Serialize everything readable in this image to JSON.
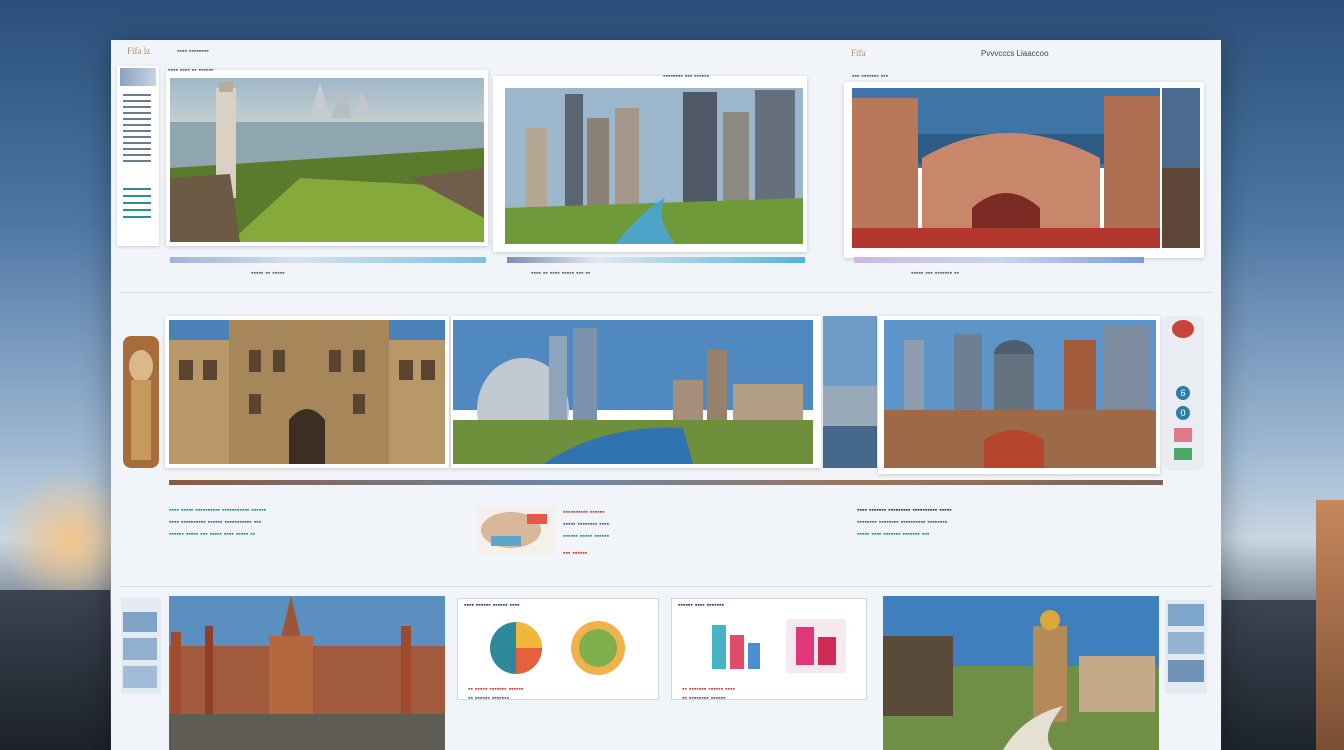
{
  "header": {
    "left_brand": "Fifa lz",
    "left_meta": "▪▪▪▪ ▪▪▪▪▪▪▪▪",
    "right_brand": "Fifa",
    "right_title": "Pvvvcccs Liaaccoo"
  },
  "card1": {
    "caption": "▪▪▪▪ ▪▪▪▪ ▪▪ ▪▪▪▪▪▪",
    "footer": "▪▪▪▪▪ ▪▪ ▪▪▪▪▪"
  },
  "card2": {
    "caption": "▪▪▪▪▪▪▪▪ ▪▪▪ ▪▪▪▪▪▪",
    "footer": "▪▪▪▪ ▪▪ ▪▪▪▪ ▪▪▪▪▪ ▪▪▪ ▪▪"
  },
  "card3": {
    "caption": "▪▪▪ ▪▪▪▪▪▪▪ ▪▪▪",
    "footer": "▪▪▪▪▪ ▪▪▪ ▪▪▪▪▪▪▪ ▪▪"
  },
  "section": {
    "text_left": [
      "▪▪▪▪ ▪▪▪▪▪ ▪▪▪▪▪▪▪▪▪▪ ▪▪▪▪▪▪▪▪▪▪▪ ▪▪▪▪▪▪",
      "▪▪▪▪ ▪▪▪▪▪▪▪▪▪▪ ▪▪▪▪▪▪ ▪▪▪▪▪▪▪▪▪▪▪ ▪▪▪",
      "▪▪▪▪▪▪ ▪▪▪▪▪ ▪▪▪ ▪▪▪▪▪ ▪▪▪▪ ▪▪▪▪▪ ▪▪"
    ],
    "text_mid": [
      "▪▪▪▪▪▪▪▪▪▪ ▪▪▪▪▪▪",
      "▪▪▪▪▪ ▪▪▪▪▪▪▪▪ ▪▪▪▪",
      "▪▪▪▪▪▪ ▪▪▪▪▪ ▪▪▪▪▪▪",
      "▪▪▪ ▪▪▪▪▪▪"
    ],
    "text_right": [
      "▪▪▪▪ ▪▪▪▪▪▪▪ ▪▪▪▪▪▪▪▪▪ ▪▪▪▪▪▪▪▪▪▪ ▪▪▪▪▪",
      "▪▪▪▪▪▪▪▪ ▪▪▪▪▪▪▪▪ ▪▪▪▪▪▪▪▪▪▪ ▪▪▪▪▪▪▪▪",
      "▪▪▪▪▪ ▪▪▪▪ ▪▪▪▪▪▪▪ ▪▪▪▪▪▪▪ ▪▪▪"
    ]
  },
  "bottom": {
    "panel1_title": "▪▪▪▪ ▪▪▪▪▪▪ ▪▪▪▪▪▪ ▪▪▪▪",
    "panel1_lines": [
      "▪▪ ▪▪▪▪▪ ▪▪▪▪▪▪▪ ▪▪▪▪▪▪",
      "▪▪ ▪▪▪▪▪▪ ▪▪▪▪▪▪▪",
      "▪▪ ▪▪▪▪▪▪▪ ▪▪▪"
    ],
    "panel2_title": "▪▪▪▪▪▪ ▪▪▪▪ ▪▪▪▪▪▪▪",
    "panel2_lines": [
      "▪▪ ▪▪▪▪▪▪▪ ▪▪▪▪▪▪ ▪▪▪▪",
      "▪▪ ▪▪▪▪▪▪▪▪ ▪▪▪▪▪▪",
      "▪▪ ▪▪▪▪▪ ▪▪▪▪▪"
    ]
  },
  "badges": [
    "6",
    "0"
  ],
  "colors": {
    "accent_teal": "#2c8f8f",
    "accent_red": "#c24a3c",
    "brand_gold": "#a8925a"
  }
}
